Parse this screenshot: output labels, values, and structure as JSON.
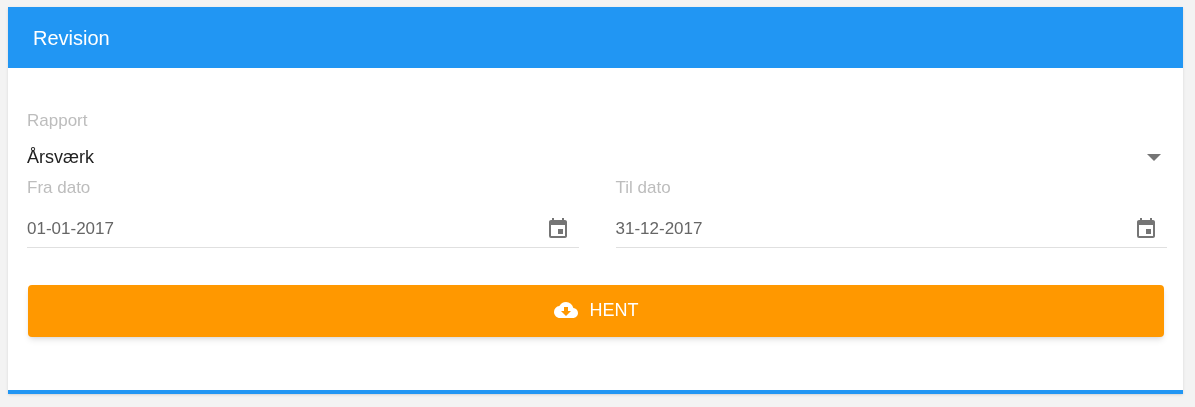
{
  "card": {
    "title": "Revision"
  },
  "report": {
    "label": "Rapport",
    "value": "Årsværk"
  },
  "date_fields": [
    {
      "label": "Fra dato",
      "value": "01-01-2017"
    },
    {
      "label": "Til dato",
      "value": "31-12-2017"
    }
  ],
  "button": {
    "label": "HENT"
  }
}
